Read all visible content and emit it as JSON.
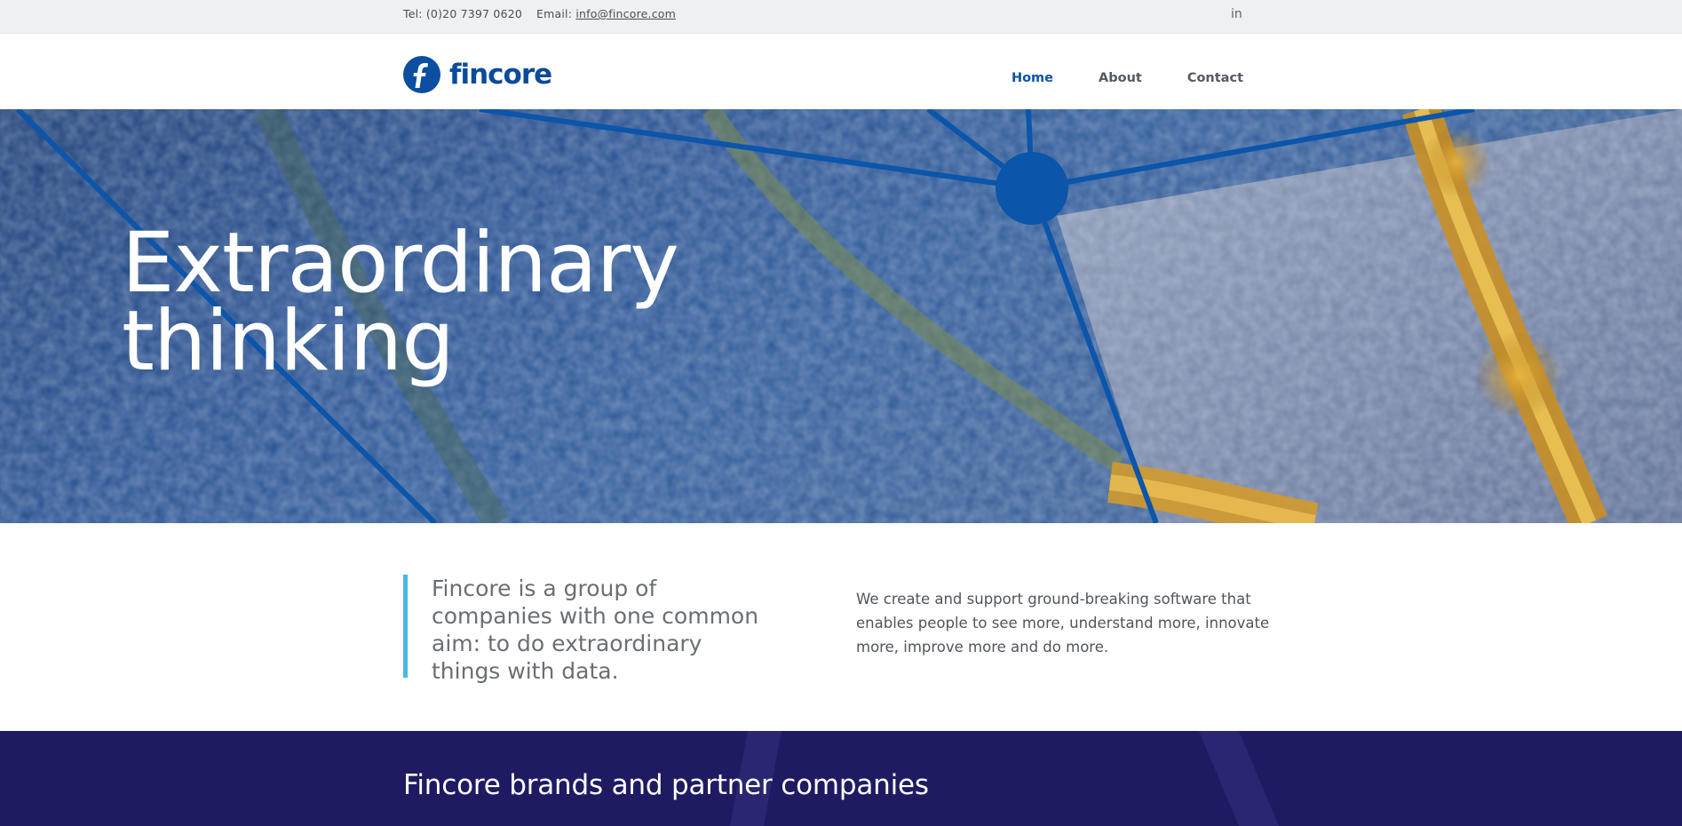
{
  "topbar": {
    "tel": "Tel: (0)20 7397 0620",
    "email_label": "Email:",
    "email": "info@fincore.com",
    "social_icon": "linkedin-icon",
    "social_text": "in"
  },
  "header": {
    "logo_text": "fincore",
    "nav": [
      {
        "label": "Home",
        "active": true
      },
      {
        "label": "About",
        "active": false
      },
      {
        "label": "Contact",
        "active": false
      }
    ]
  },
  "hero": {
    "line1": "Extraordinary",
    "line2": "thinking"
  },
  "intro": {
    "quote": "Fincore is a group of companies with one common aim: to do extraordinary things with data.",
    "description": "We create and support ground-breaking software that enables people to see more, understand more, innovate more, improve more and do more."
  },
  "brands": {
    "heading": "Fincore brands and partner companies"
  },
  "colors": {
    "brand_blue": "#0b52a8",
    "accent_cyan": "#47b8e6",
    "brands_bg": "#1e1b63",
    "topbar_bg": "#edf1f4"
  }
}
